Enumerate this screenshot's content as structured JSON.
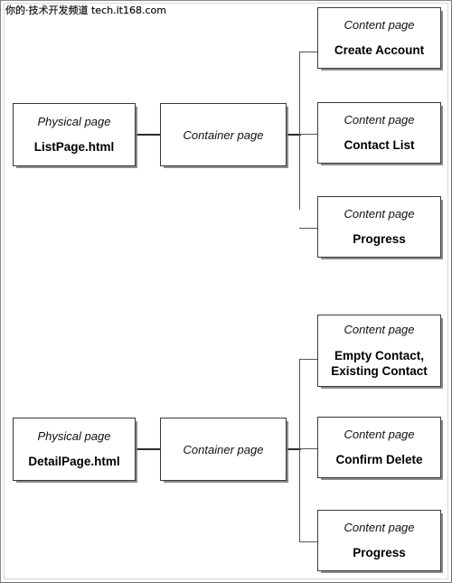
{
  "watermark": {
    "text": "你的·技术开发频道  tech.it168.com"
  },
  "diagram": {
    "groups": [
      {
        "id": "list-page-group",
        "physical": {
          "kind": "Physical page",
          "title": "ListPage.html"
        },
        "container": {
          "kind": "Container page"
        },
        "contents": [
          {
            "kind": "Content page",
            "title": "Create Account"
          },
          {
            "kind": "Content page",
            "title": "Contact List"
          },
          {
            "kind": "Content page",
            "title": "Progress"
          }
        ]
      },
      {
        "id": "detail-page-group",
        "physical": {
          "kind": "Physical page",
          "title": "DetailPage.html"
        },
        "container": {
          "kind": "Container page"
        },
        "contents": [
          {
            "kind": "Content page",
            "title": "Empty Contact,\nExisting Contact"
          },
          {
            "kind": "Content page",
            "title": "Confirm Delete"
          },
          {
            "kind": "Content page",
            "title": "Progress"
          }
        ]
      }
    ]
  },
  "colors": {
    "page_background": "#ffffff",
    "box_border": "#3a3a3a",
    "box_shadow": "#787878",
    "connector": "#2b2b2b",
    "text": "#000000"
  }
}
